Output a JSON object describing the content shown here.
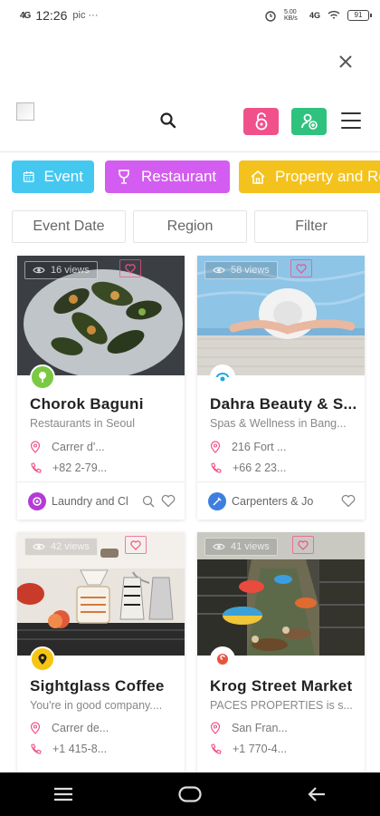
{
  "status_bar": {
    "signal": "4G",
    "time": "12:26",
    "extra": "pic ···",
    "speed": "5.00 KB/s",
    "network": "4G",
    "battery": "91"
  },
  "header": {
    "close_icon": "close-icon",
    "logo_alt": "logo"
  },
  "categories": [
    {
      "label": "Event",
      "color": "#45c8f0",
      "icon": "calendar-icon"
    },
    {
      "label": "Restaurant",
      "color": "#d35df0",
      "icon": "cup-icon"
    },
    {
      "label": "Property and Re",
      "color": "#f4c21c",
      "icon": "home-icon"
    }
  ],
  "filters": [
    "Event Date",
    "Region",
    "Filter"
  ],
  "cards": [
    {
      "views": "16 views",
      "title": "Chorok Baguni",
      "subtitle": "Restaurants in Seoul",
      "address": "Carrer d'...",
      "phone": "+82 2-79...",
      "category_color": "#7ac943",
      "footer_label": "Laundry and Cl",
      "footer_color": "#b43bd6"
    },
    {
      "views": "58 views",
      "title": "Dahra Beauty & S...",
      "subtitle": "Spas & Wellness in Bang...",
      "address": "216 Fort ...",
      "phone": "+66 2 23...",
      "category_color": "#ffffff",
      "footer_label": "Carpenters & Jo",
      "footer_color": "#3d7fe0"
    },
    {
      "views": "42 views",
      "title": "Sightglass Coffee",
      "subtitle": "You're in good company....",
      "address": "Carrer de...",
      "phone": "+1 415-8...",
      "category_color": "#f6c512"
    },
    {
      "views": "41 views",
      "title": "Krog Street Market",
      "subtitle": "PACES PROPERTIES is s...",
      "address": "San Fran...",
      "phone": "+1 770-4...",
      "category_color": "#ffffff"
    }
  ]
}
